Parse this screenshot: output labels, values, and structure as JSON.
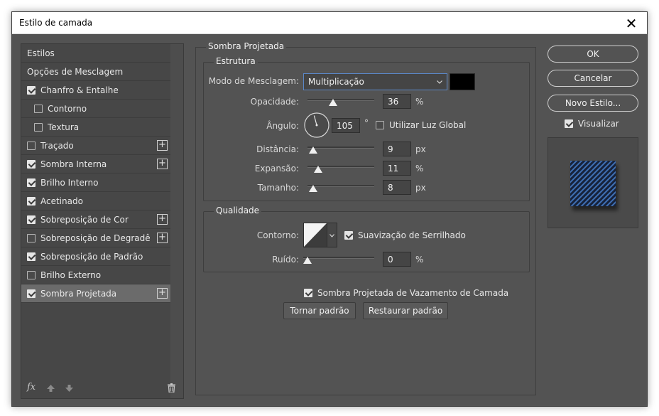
{
  "window": {
    "title": "Estilo de camada",
    "close_glyph": "✕"
  },
  "styles_panel": {
    "items": [
      {
        "label": "Estilos",
        "checkbox": null,
        "plus": false,
        "indent": false,
        "selected": false
      },
      {
        "label": "Opções de Mesclagem",
        "checkbox": null,
        "plus": false,
        "indent": false,
        "selected": false
      },
      {
        "label": "Chanfro & Entalhe",
        "checkbox": true,
        "plus": false,
        "indent": false,
        "selected": false
      },
      {
        "label": "Contorno",
        "checkbox": false,
        "plus": false,
        "indent": true,
        "selected": false
      },
      {
        "label": "Textura",
        "checkbox": false,
        "plus": false,
        "indent": true,
        "selected": false
      },
      {
        "label": "Traçado",
        "checkbox": false,
        "plus": true,
        "indent": false,
        "selected": false
      },
      {
        "label": "Sombra Interna",
        "checkbox": true,
        "plus": true,
        "indent": false,
        "selected": false
      },
      {
        "label": "Brilho Interno",
        "checkbox": true,
        "plus": false,
        "indent": false,
        "selected": false
      },
      {
        "label": "Acetinado",
        "checkbox": true,
        "plus": false,
        "indent": false,
        "selected": false
      },
      {
        "label": "Sobreposição de Cor",
        "checkbox": true,
        "plus": true,
        "indent": false,
        "selected": false
      },
      {
        "label": "Sobreposição de Degradê",
        "checkbox": false,
        "plus": true,
        "indent": false,
        "selected": false
      },
      {
        "label": "Sobreposição de Padrão",
        "checkbox": true,
        "plus": false,
        "indent": false,
        "selected": false
      },
      {
        "label": "Brilho Externo",
        "checkbox": false,
        "plus": false,
        "indent": false,
        "selected": false
      },
      {
        "label": "Sombra Projetada",
        "checkbox": true,
        "plus": true,
        "indent": false,
        "selected": true
      }
    ],
    "footer": {
      "fx_label": "fx",
      "up_icon": "arrow-up-icon",
      "down_icon": "arrow-down-icon",
      "trash_icon": "trash-icon"
    }
  },
  "drop_shadow": {
    "section_title": "Sombra Projetada",
    "structure": {
      "title": "Estrutura",
      "blend_mode_label": "Modo de Mesclagem:",
      "blend_mode_value": "Multiplicação",
      "shadow_color": "#000000",
      "opacity_label": "Opacidade:",
      "opacity_value": "36",
      "opacity_unit": "%",
      "opacity_fraction": 0.36,
      "angle_label": "Ângulo:",
      "angle_value": "105",
      "angle_unit": "°",
      "angle_degrees": 105,
      "global_light_label": "Utilizar Luz Global",
      "global_light_checked": false,
      "distance_label": "Distância:",
      "distance_value": "9",
      "distance_unit": "px",
      "distance_fraction": 0.03,
      "spread_label": "Expansão:",
      "spread_value": "11",
      "spread_unit": "%",
      "spread_fraction": 0.11,
      "size_label": "Tamanho:",
      "size_value": "8",
      "size_unit": "px",
      "size_fraction": 0.03
    },
    "quality": {
      "title": "Qualidade",
      "contour_label": "Contorno:",
      "antialias_label": "Suavização de Serrilhado",
      "antialias_checked": true,
      "noise_label": "Ruído:",
      "noise_value": "0",
      "noise_unit": "%",
      "noise_fraction": 0.0
    },
    "knockout_label": "Sombra Projetada de Vazamento de Camada",
    "knockout_checked": true,
    "make_default_label": "Tornar padrão",
    "reset_default_label": "Restaurar padrão"
  },
  "actions": {
    "ok_label": "OK",
    "cancel_label": "Cancelar",
    "new_style_label": "Novo Estilo...",
    "preview_label": "Visualizar",
    "preview_checked": true
  }
}
